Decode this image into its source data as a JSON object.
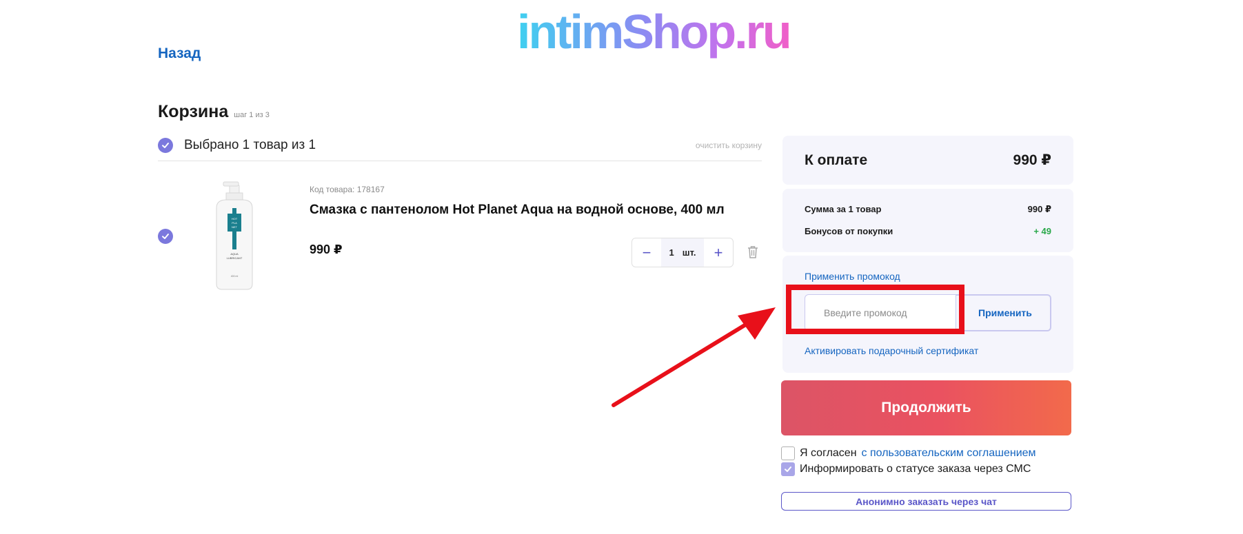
{
  "header": {
    "logo_text": "intimShop.ru",
    "back_label": "Назад"
  },
  "cart": {
    "title": "Корзина",
    "step": "шаг 1 из 3",
    "selected_label": "Выбрано 1 товар из 1",
    "clear_label": "очистить корзину"
  },
  "item": {
    "code_label": "Код товара: 178167",
    "name": "Смазка с пантенолом Hot Planet Aqua на водной основе, 400 мл",
    "price": "990 ₽",
    "quantity": "1",
    "unit": "шт.",
    "image_text": [
      "HOT",
      "PLA",
      "NET",
      "AQUA",
      "LUBRICANT",
      "400 ml"
    ]
  },
  "summary": {
    "total_label": "К оплате",
    "total_value": "990 ₽",
    "sum_label": "Сумма за 1 товар",
    "sum_value": "990 ₽",
    "bonus_label": "Бонусов от покупки",
    "bonus_value": "+ 49"
  },
  "promo": {
    "link_label": "Применить промокод",
    "placeholder": "Введите промокод",
    "value": "",
    "apply_label": "Применить",
    "gift_label": "Активировать подарочный сертификат"
  },
  "actions": {
    "continue_label": "Продолжить",
    "agree_text": "Я согласен",
    "agree_link": "с пользовательским соглашением",
    "agree_checked": false,
    "sms_text": "Информировать о статусе заказа через СМС",
    "sms_checked": true,
    "anon_label": "Анонимно заказать через чат"
  },
  "colors": {
    "accent_purple": "#7b78dd",
    "link_blue": "#1565c0",
    "continue_gradient_start": "#dc5466",
    "continue_gradient_end": "#f26a4b",
    "bonus_green": "#2aa84a",
    "annotation_red": "#e8101a"
  },
  "icons": {
    "select_all": "check-circle-icon",
    "item_select": "check-circle-icon",
    "decrease": "minus-icon",
    "increase": "plus-icon",
    "delete": "trash-icon",
    "sms_checkbox": "checkmark-icon"
  }
}
